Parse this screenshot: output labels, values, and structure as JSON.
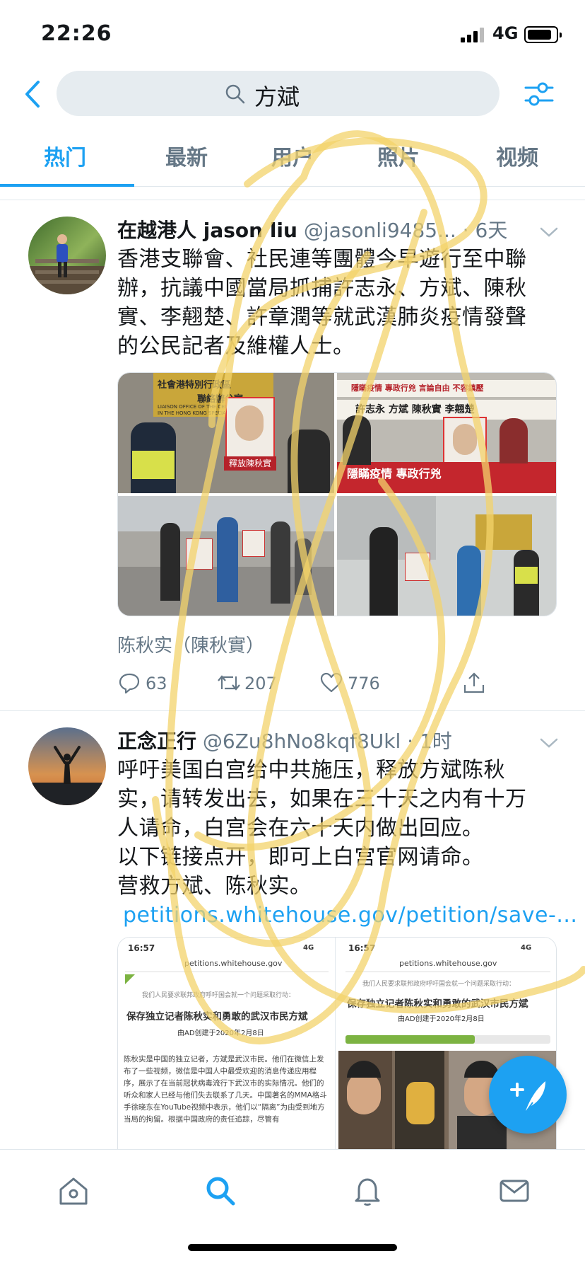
{
  "status_bar": {
    "time": "22:26",
    "network": "4G"
  },
  "search": {
    "query": "方斌"
  },
  "tabs": [
    "热门",
    "最新",
    "用户",
    "照片",
    "视频"
  ],
  "tweets": [
    {
      "name": "在越港人 jason liu",
      "handle": "@jasonli9485...",
      "time": "· 6天",
      "body_lines": [
        "香港支聯會、社民連等團體今早遊行至中聯",
        "辦，抗議中國當局抓捕許志永、方斌、陳秋",
        "實、李翹楚、許章潤等就武漢肺炎疫情發聲",
        "的公民記者及維權人士。"
      ],
      "photo_signs": {
        "p1_sign_top": "社會港特別行政區",
        "p1_sign_sub": "聯絡辦公室",
        "p1_sign_en1": "LIAISON OFFICE OF THE CENTRAL",
        "p1_sign_en2": "IN THE HONG KONG SPECIAL AD",
        "p1_placard": "釋放陳秋實",
        "p2_banner_top": "隱瞞疫情 專政行兇 言論自由 不容鎮壓",
        "p2_names": "許志永 方斌 陳秋實 李翹楚",
        "p2_banner_bottom": "隱瞞疫情 專政行兇"
      },
      "media_tag": "陈秋实（陳秋實）",
      "replies": "63",
      "retweets": "207",
      "likes": "776"
    },
    {
      "name": "正念正行",
      "handle": "@6Zu8hNo8kqf8Ukl",
      "time": "· 1时",
      "body_lines": [
        "呼吁美国白宫给中共施压，释放方斌陈秋",
        "实，请转发出去，如果在三十天之内有十万",
        "人请命，白宫会在六十天内做出回应。",
        "以下链接点开，即可上白宫官网请命。",
        "营救方斌、陈秋实。"
      ],
      "link": "petitions.whitehouse.gov/petition/save-...",
      "screens": [
        {
          "time": "16:57",
          "net": "4G",
          "url": "petitions.whitehouse.gov",
          "ask": "我们人民要求联邦政府呼吁国会就一个问题采取行动：",
          "title": "保存独立记者陈秋实和勇敢的武汉市民方斌",
          "created": "由AD创建于2020年2月8日",
          "paragraph": "陈秋实是中国的独立记者，方斌是武汉市民。他们在微信上发布了一些视频，微信是中国人中最受欢迎的消息传递应用程序，展示了在当前冠状病毒流行下武汉市的实际情况。他们的听众和家人已经与他们失去联系了几天。中国著名的MMA格斗手徐晓东在YouTube视频中表示，他们以“隔离”为由受到地方当局的拘留。根据中国政府的责任追踪，尽管有"
        },
        {
          "time": "16:57",
          "net": "4G",
          "url": "petitions.whitehouse.gov",
          "ask": "我们人民要求联邦政府呼吁国会就一个问题采取行动：",
          "title": "保存独立记者陈秋实和勇敢的武汉市民方斌",
          "created": "由AD创建于2020年2月8日",
          "progress": 0.63
        }
      ]
    }
  ],
  "colors": {
    "accent": "#1da1f2",
    "muted": "#657786",
    "scribble": "#f3d36b"
  }
}
